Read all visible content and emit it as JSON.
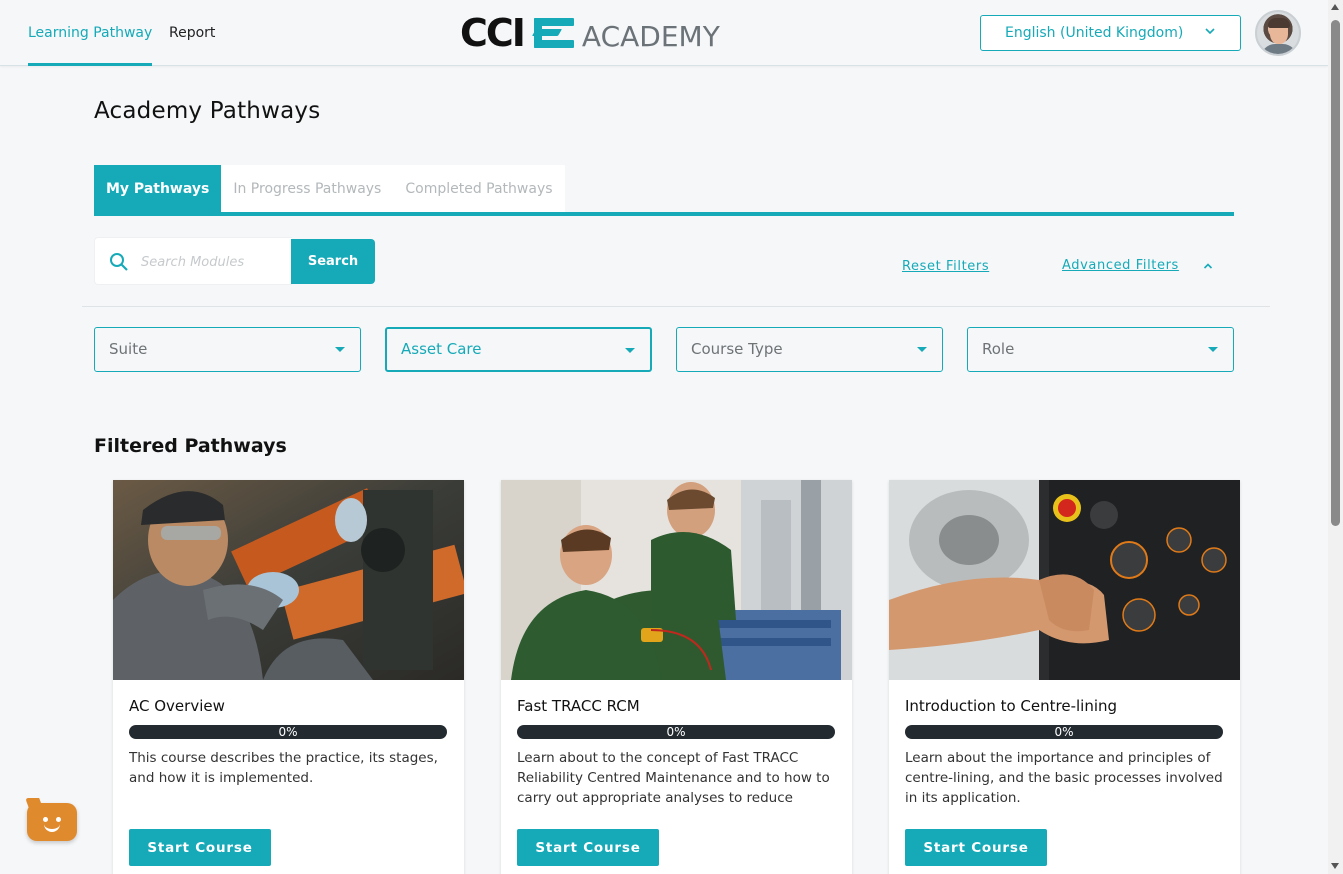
{
  "nav": {
    "links": [
      "Learning Pathway",
      "Report"
    ],
    "logo_text": "CCI",
    "logo_sub": "ACADEMY",
    "language": "English (United Kingdom)"
  },
  "page": {
    "title": "Academy Pathways",
    "tabs": [
      "My Pathways",
      "In Progress Pathways",
      "Completed Pathways"
    ],
    "active_tab": "My Pathways"
  },
  "search": {
    "placeholder": "Search Modules",
    "button": "Search"
  },
  "filters": {
    "reset": "Reset Filters",
    "advanced": "Advanced Filters",
    "dropdowns": [
      {
        "label": "Suite",
        "selected": false
      },
      {
        "label": "Asset Care",
        "selected": true
      },
      {
        "label": "Course Type",
        "selected": false
      },
      {
        "label": "Role",
        "selected": false
      }
    ]
  },
  "section_title": "Filtered Pathways",
  "cards": [
    {
      "title": "AC Overview",
      "progress": 0,
      "progress_label": "0%",
      "description": "This course describes the practice, its stages, and how it is implemented.",
      "button": "Start Course"
    },
    {
      "title": "Fast TRACC RCM",
      "progress": 0,
      "progress_label": "0%",
      "description": "Learn about to the concept of Fast TRACC Reliability Centred Maintenance and to how to carry out appropriate analyses to reduce",
      "button": "Start Course"
    },
    {
      "title": "Introduction to Centre-lining",
      "progress": 0,
      "progress_label": "0%",
      "description": "Learn about the importance and principles of centre-lining, and the basic processes involved in its application.",
      "button": "Start Course"
    }
  ],
  "colors": {
    "accent": "#16aab8",
    "progress_track": "#232b31",
    "chat_widget": "#e08a2e"
  }
}
